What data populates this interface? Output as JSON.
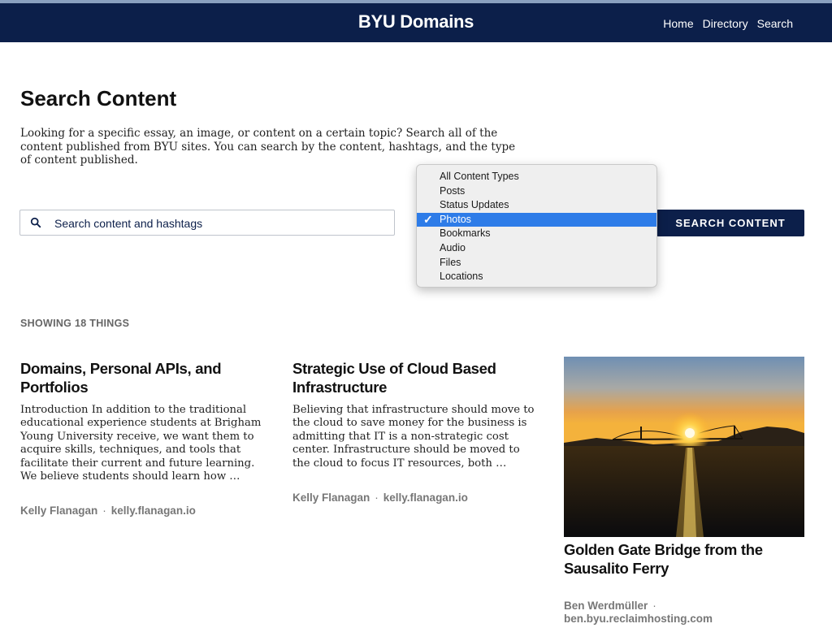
{
  "header": {
    "brand": "BYU Domains",
    "nav": [
      "Home",
      "Directory",
      "Search"
    ]
  },
  "main": {
    "title": "Search Content",
    "intro": "Looking for a specific essay, an image, or content on a certain topic? Search all of the content published from BYU sites. You can search by the content, hashtags, and the type of content published.",
    "search": {
      "placeholder": "Search content and hashtags",
      "value": "",
      "submit_label": "SEARCH CONTENT"
    },
    "content_type_select": {
      "options": [
        "All Content Types",
        "Posts",
        "Status Updates",
        "Photos",
        "Bookmarks",
        "Audio",
        "Files",
        "Locations"
      ],
      "selected": "Photos"
    },
    "results_count": "SHOWING 18 THINGS",
    "results": [
      {
        "title": "Domains, Personal APIs, and Portfolios",
        "excerpt": "Introduction In addition to the traditional educational experience students at Brigham Young University receive, we want them to acquire skills, techniques, and tools that facilitate their current and future learning. We believe students should learn how …",
        "author": "Kelly Flanagan",
        "site": "kelly.flanagan.io"
      },
      {
        "title": "Strategic Use of Cloud Based Infrastructure",
        "excerpt": "Believing that infrastructure should move to the cloud to save money for the business is admitting that IT is a non-strategic cost center. Infrastructure should be moved to the cloud to focus IT resources, both …",
        "author": "Kelly Flanagan",
        "site": "kelly.flanagan.io"
      },
      {
        "title": "Golden Gate Bridge from the Sausalito Ferry",
        "author": "Ben Werdmüller",
        "site": "ben.byu.reclaimhosting.com"
      }
    ]
  },
  "colors": {
    "header_bg": "#0c1f4a",
    "accent": "#0c1f4a",
    "select_highlight": "#2e7ce8",
    "meta_text": "#777777"
  },
  "icons": {
    "search": "search-icon",
    "check": "checkmark-icon"
  }
}
